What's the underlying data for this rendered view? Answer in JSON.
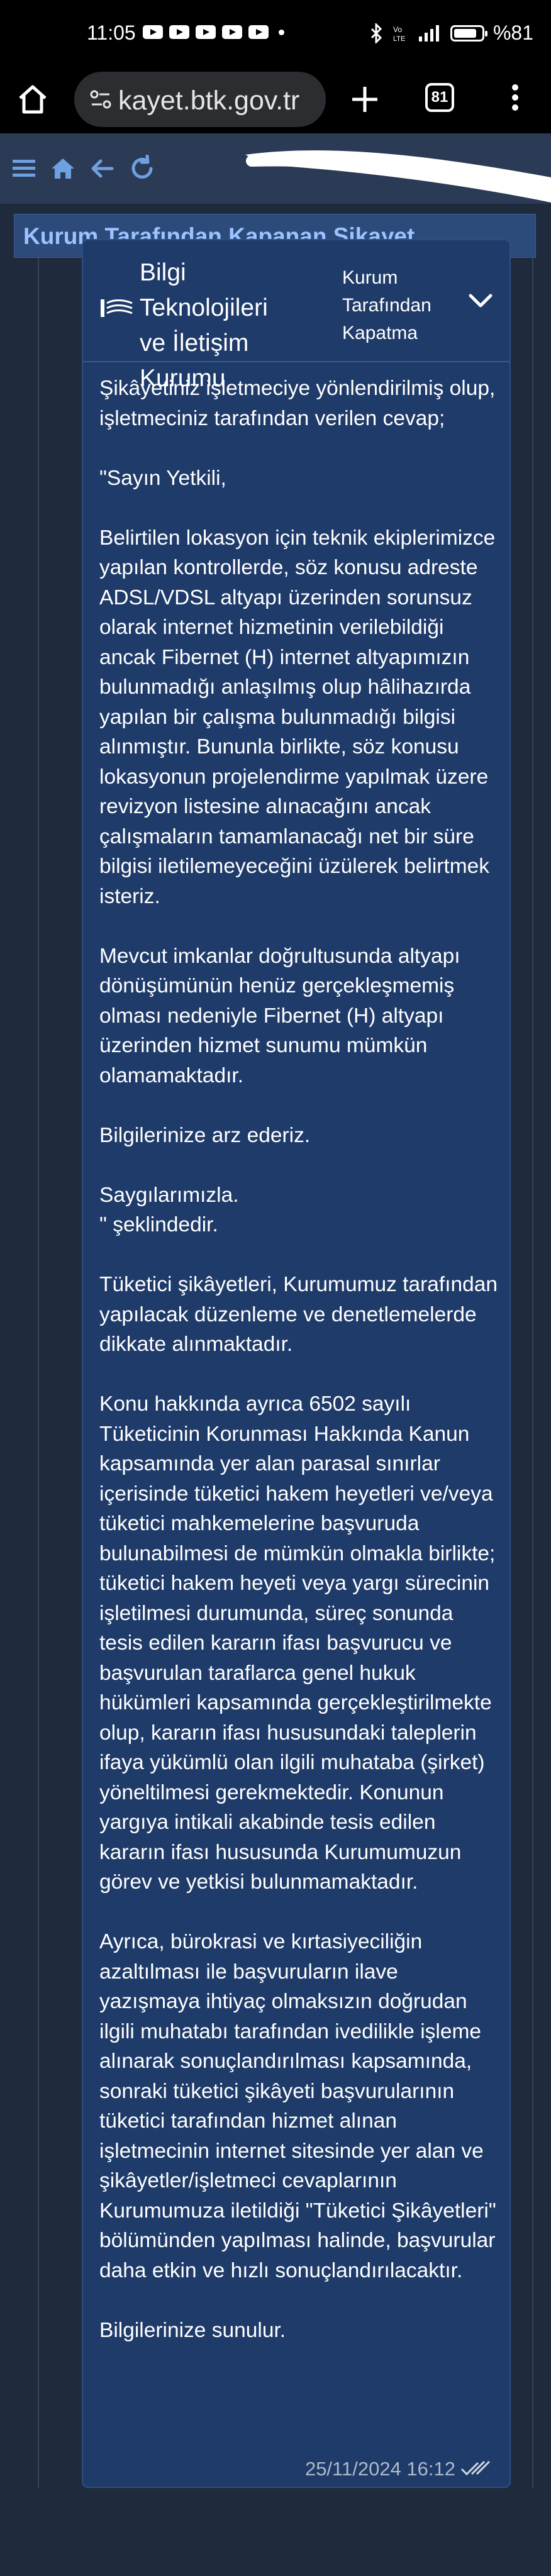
{
  "status_bar": {
    "time": "11:05",
    "battery": "%81",
    "notification_count": 5
  },
  "browser": {
    "url": "kayet.btk.gov.tr",
    "tab_count": "81"
  },
  "page": {
    "title": "Kurum Tarafından Kapanan Şikayet"
  },
  "card": {
    "org_name": "Bilgi Teknolojileri ve İletişim Kurumu",
    "status": "Kurum Tarafından Kapatma",
    "message": "Şikâyetiniz işletmeciye yönlendirilmiş olup, işletmeciniz tarafından verilen cevap;\n\n\"Sayın Yetkili,\n\nBelirtilen lokasyon için teknik ekiplerimizce yapılan kontrollerde, söz konusu adreste ADSL/VDSL altyapı üzerinden sorunsuz olarak internet hizmetinin verilebildiği ancak Fibernet (H) internet altyapımızın bulunmadığı anlaşılmış olup hâlihazırda yapılan bir çalışma bulunmadığı bilgisi alınmıştır. Bununla birlikte, söz konusu lokasyonun projelendirme yapılmak üzere revizyon listesine alınacağını ancak çalışmaların tamamlanacağı net bir süre bilgisi iletilemeyeceğini üzülerek belirtmek isteriz.\n\nMevcut imkanlar doğrultusunda altyapı dönüşümünün henüz gerçekleşmemiş olması nedeniyle Fibernet (H) altyapı üzerinden hizmet sunumu mümkün olamamaktadır.\n\nBilgilerinize arz ederiz.\n\nSaygılarımızla.\n\" şeklindedir.\n\nTüketici şikâyetleri, Kurumumuz tarafından yapılacak düzenleme ve denetlemelerde dikkate alınmaktadır.\n\nKonu hakkında ayrıca 6502 sayılı Tüketicinin Korunması Hakkında Kanun kapsamında yer alan parasal sınırlar içerisinde tüketici hakem heyetleri ve/veya tüketici mahkemelerine başvuruda bulunabilmesi de mümkün olmakla birlikte; tüketici hakem heyeti veya yargı sürecinin işletilmesi durumunda, süreç sonunda tesis edilen kararın ifası başvurucu ve başvurulan taraflarca genel hukuk hükümleri kapsamında gerçekleştirilmekte olup, kararın ifası hususundaki taleplerin ifaya yükümlü olan ilgili muhataba (şirket) yöneltilmesi gerekmektedir. Konunun yargıya intikali akabinde tesis edilen kararın ifası hususunda Kurumumuzun görev ve yetkisi bulunmamaktadır.\n\nAyrıca, bürokrasi ve kırtasiyeciliğin azaltılması ile başvuruların ilave yazışmaya ihtiyaç olmaksızın doğrudan ilgili muhatabı tarafından ivedilikle işleme alınarak sonuçlandırılması kapsamında, sonraki tüketici şikâyeti başvurularının tüketici tarafından hizmet alınan işletmecinin internet sitesinde yer alan ve şikâyetler/işletmeci cevaplarının Kurumumuza iletildiği \"Tüketici Şikâyetleri\" bölümünden yapılması halinde, başvurular daha etkin ve hızlı sonuçlandırılacaktır.\n\nBilgilerinize sunulur.",
    "timestamp": "25/11/2024 16:12"
  },
  "colors": {
    "page_bg": "#1f2a3d",
    "card_bg": "#1f3b6a",
    "title_color": "#9cc2ff",
    "nav_bg": "#2b3a55"
  }
}
